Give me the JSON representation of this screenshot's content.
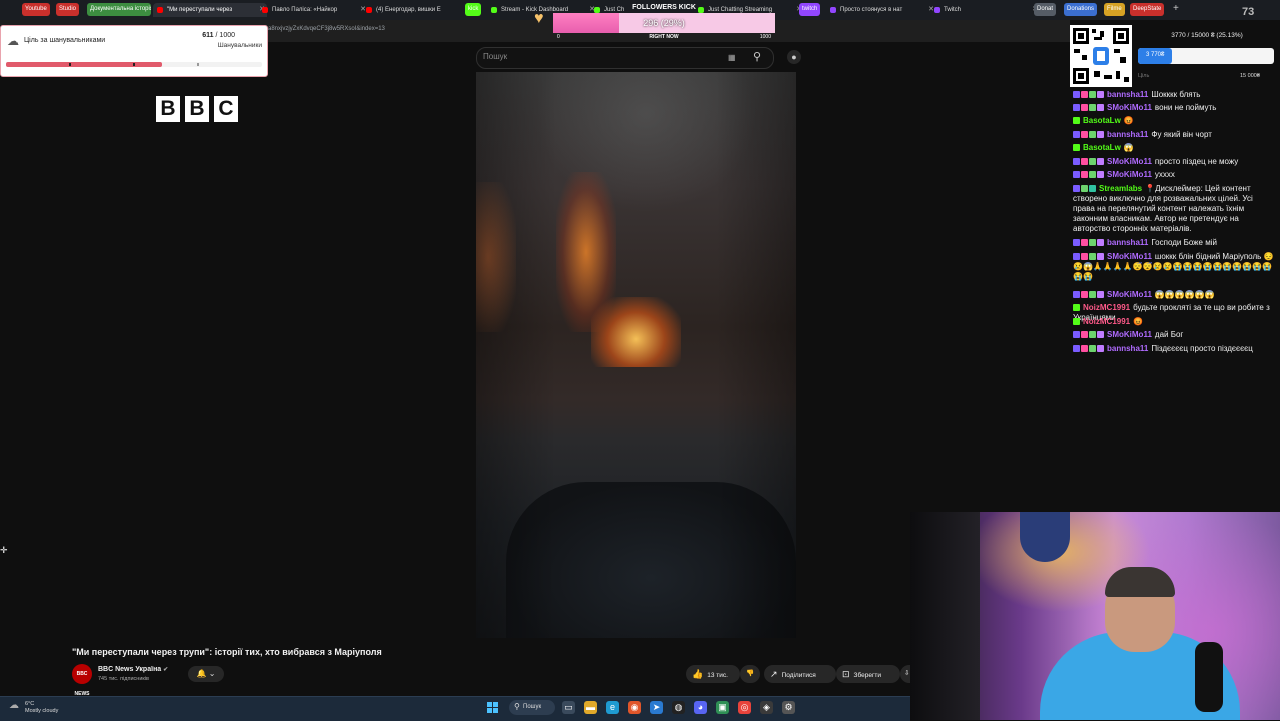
{
  "bookmarks": [
    {
      "label": "Youtube",
      "color": "#c9302c"
    },
    {
      "label": "Studio",
      "color": "#c9302c"
    },
    {
      "label": "Документальна історія",
      "color": "#3c8d40"
    }
  ],
  "tabs": [
    {
      "label": "\"Ми переступали через",
      "color": "#ff0000",
      "active": true
    },
    {
      "label": "Павло Паліса: «Найкор",
      "color": "#ff0000"
    },
    {
      "label": "(4) Енергодар, вишки Е",
      "color": "#ff0000"
    },
    {
      "label": "kick",
      "color": "#53fc18"
    },
    {
      "label": "Stream - Kick Dashboard",
      "color": "#53fc18"
    },
    {
      "label": "Just Ch",
      "color": "#53fc18"
    },
    {
      "label": "Just Chatting Streaming",
      "color": "#53fc18"
    },
    {
      "label": "twitch",
      "color": "#9146ff"
    },
    {
      "label": "Просто стоянуся в нат",
      "color": "#9146ff"
    },
    {
      "label": "Twitch",
      "color": "#9146ff"
    }
  ],
  "right_bookmarks": [
    {
      "label": "Donat",
      "color": "#555c66"
    },
    {
      "label": "Donations",
      "color": "#3b6fd1"
    },
    {
      "label": "Filme",
      "color": "#d6a224"
    },
    {
      "label": "DeepState",
      "color": "#c9302c"
    }
  ],
  "corner_number": "73",
  "url": "a8nxjvzjyZxKdvqeCF3j8w5RXsoI&index=13",
  "followers_widget": {
    "title": "FOLLOWERS KICK",
    "count": "296 (29%)",
    "progress": 0.296,
    "min": "0",
    "label": "RIGHT NOW",
    "max": "1000",
    "heart_color": "#f5c16a"
  },
  "goal_widget": {
    "label": "Ціль за шанувальниками",
    "current": "611",
    "total": "/ 1000",
    "subtitle": "Шанувальники",
    "progress": 0.611,
    "fill_color": "#e15a6b"
  },
  "search": {
    "placeholder": "Пошук"
  },
  "video": {
    "logo": [
      "B",
      "B",
      "C"
    ],
    "title": "\"Ми переступали через трупи\": історії тих, хто вибрався з Маріуполя",
    "channel": "BBC News Україна",
    "channel_avatar_text": "BBC NEWS",
    "verified": "✔",
    "subscribers": "745 тис. підписників",
    "likes": "13 тис.",
    "share_label": "Поділитися",
    "save_label": "Зберегти"
  },
  "taskbar": {
    "weather_temp": "6°C",
    "weather_desc": "Mostly cloudy",
    "search_label": "Пошук"
  },
  "donation_widget": {
    "title": "3770 / 15000 ₴ (25.13%)",
    "raised": "3 770₴",
    "progress": 0.2513,
    "min": "Ціль",
    "max": "15 000₴",
    "color": "#2d7fe8"
  },
  "chat": [
    {
      "user": "bannsha11",
      "color": "#b06bff",
      "text": "Шокккк блять",
      "badges": [
        "#7a5cff",
        "#ff4fa0",
        "#6dd36d",
        "#c07cff"
      ]
    },
    {
      "user": "SMoKiMo11",
      "color": "#b06bff",
      "text": "вони не поймуть",
      "badges": [
        "#7a5cff",
        "#ff4fa0",
        "#6dd36d",
        "#c07cff"
      ]
    },
    {
      "user": "BasotaLw",
      "color": "#53fc18",
      "text": "😡",
      "badges": [
        "#53fc18"
      ]
    },
    {
      "user": "bannsha11",
      "color": "#b06bff",
      "text": "Фу який він чорт",
      "badges": [
        "#7a5cff",
        "#ff4fa0",
        "#6dd36d",
        "#c07cff"
      ]
    },
    {
      "user": "BasotaLw",
      "color": "#53fc18",
      "text": "😱",
      "badges": [
        "#53fc18"
      ]
    },
    {
      "user": "SMoKiMo11",
      "color": "#b06bff",
      "text": "просто піздец не можу",
      "badges": [
        "#7a5cff",
        "#ff4fa0",
        "#6dd36d",
        "#c07cff"
      ]
    },
    {
      "user": "SMoKiMo11",
      "color": "#b06bff",
      "text": "ухххх",
      "badges": [
        "#7a5cff",
        "#ff4fa0",
        "#6dd36d",
        "#c07cff"
      ]
    },
    {
      "user": "Streamlabs",
      "color": "#53fc18",
      "text": "📍Дисклеймер: Цей контент створено виключно для розважальних цілей. Усі права на перелянутий контент належать їхнім законним власникам. Автор не претендує на авторство сторонніх матеріалів.",
      "badges": [
        "#7a5cff",
        "#6dd36d",
        "#31c3a2"
      ]
    },
    {
      "user": "bannsha11",
      "color": "#b06bff",
      "text": "Господи Боже мій",
      "badges": [
        "#7a5cff",
        "#ff4fa0",
        "#6dd36d",
        "#c07cff"
      ]
    },
    {
      "user": "SMoKiMo11",
      "color": "#b06bff",
      "text": "шоккк блін бідний Маріуполь 😔😢😱🙏🙏🙏🙏😴😴😢😢😭😭😭😭😭😭😭😭😭😭😭😭",
      "badges": [
        "#7a5cff",
        "#ff4fa0",
        "#6dd36d",
        "#c07cff"
      ]
    },
    {
      "user": "SMoKiMo11",
      "color": "#b06bff",
      "text": "😱😱😱😱😱😱",
      "badges": [
        "#7a5cff",
        "#ff4fa0",
        "#6dd36d",
        "#c07cff"
      ]
    },
    {
      "user": "NoizMC1991",
      "color": "#ff5a8a",
      "text": "будьте прокляті за те що ви робите з Українцями",
      "badges": [
        "#53fc18"
      ]
    },
    {
      "user": "NoizMC1991",
      "color": "#ff5a8a",
      "text": "😡",
      "badges": [
        "#53fc18"
      ]
    },
    {
      "user": "SMoKiMo11",
      "color": "#b06bff",
      "text": "дай Бог",
      "badges": [
        "#7a5cff",
        "#ff4fa0",
        "#6dd36d",
        "#c07cff"
      ]
    },
    {
      "user": "bannsha11",
      "color": "#b06bff",
      "text": "Піздєєєєц просто піздєєєєц",
      "badges": [
        "#7a5cff",
        "#ff4fa0",
        "#6dd36d",
        "#c07cff"
      ]
    }
  ]
}
